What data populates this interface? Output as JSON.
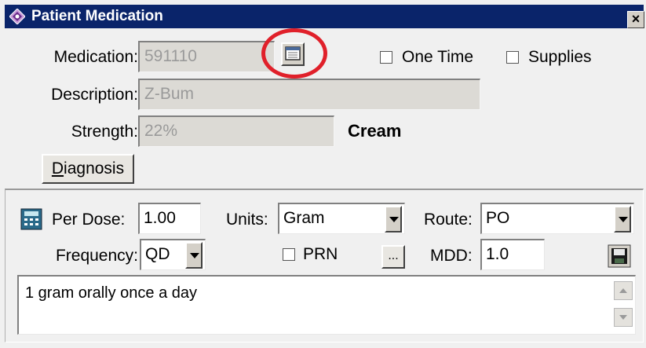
{
  "window": {
    "title": "Patient Medication",
    "close_label": "×"
  },
  "form": {
    "medication_label": "Medication:",
    "medication_value": "591110",
    "description_label": "Description:",
    "description_value": "Z-Bum",
    "strength_label": "Strength:",
    "strength_value": "22%",
    "form_value": "Cream",
    "one_time_label": "One Time",
    "supplies_label": "Supplies",
    "one_time_checked": false,
    "supplies_checked": false,
    "diagnosis_label_prefix": "D",
    "diagnosis_label_rest": "iagnosis"
  },
  "dosage": {
    "per_dose_label": "Per Dose:",
    "per_dose_value": "1.00",
    "units_label": "Units:",
    "units_value": "Gram",
    "route_label": "Route:",
    "route_value": "PO",
    "frequency_label": "Frequency:",
    "frequency_value": "QD",
    "prn_label": "PRN",
    "prn_checked": false,
    "ellipsis_label": "...",
    "mdd_label": "MDD:",
    "mdd_value": "1.0",
    "sig_text": "1 gram orally once a day"
  },
  "icons": {
    "app": "diamond-app-icon",
    "lookup": "calendar-lookup-icon",
    "calculator": "calculator-icon",
    "save": "floppy-disk-save-icon"
  },
  "colors": {
    "titlebar": "#0a246a",
    "highlight_ring": "#e0202a",
    "disabled_field": "#dcdad5"
  }
}
